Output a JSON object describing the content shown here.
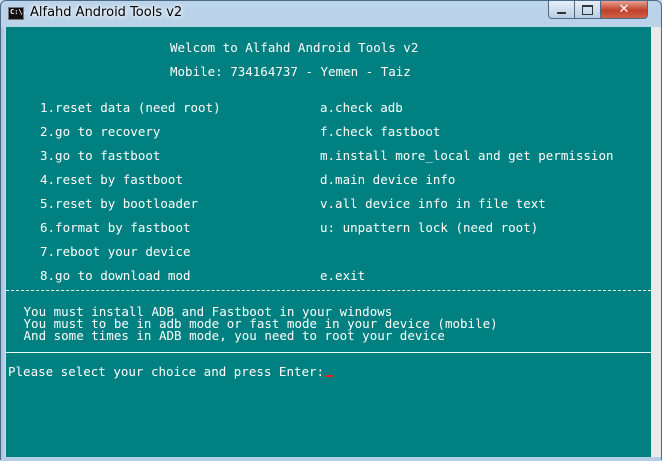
{
  "window": {
    "title": "Alfahd Android Tools v2",
    "icon": "console-icon",
    "icon_text": "C:\\.",
    "controls": {
      "minimize": "minimize-icon",
      "maximize": "maximize-icon",
      "close": "close-icon",
      "close_glyph": "✕"
    }
  },
  "console": {
    "background": "#008080",
    "text_color": "#ffffff",
    "header": {
      "welcome": "Welcom to Alfahd Android Tools v2",
      "mobile": "Mobile: 734164737 - Yemen - Taiz"
    },
    "menu_left": [
      "1.reset data (need root)",
      "2.go to recovery",
      "3.go to fastboot",
      "4.reset by fastboot",
      "5.reset by bootloader",
      "6.format by fastboot",
      "7.reboot your device",
      "8.go to download mod"
    ],
    "menu_right": [
      "a.check adb",
      "f.check fastboot",
      "m.install more_local and get permission",
      "d.main device info",
      "v.all device info in file text",
      "u: unpattern lock (need root)",
      "",
      "e.exit"
    ],
    "notes": [
      " You must install ADB and Fastboot in your windows",
      " You must to be in adb mode or fast mode in your device (mobile)",
      " And some times in ADB mode, you need to root your device"
    ],
    "prompt": "Please select your choice and press Enter:"
  }
}
